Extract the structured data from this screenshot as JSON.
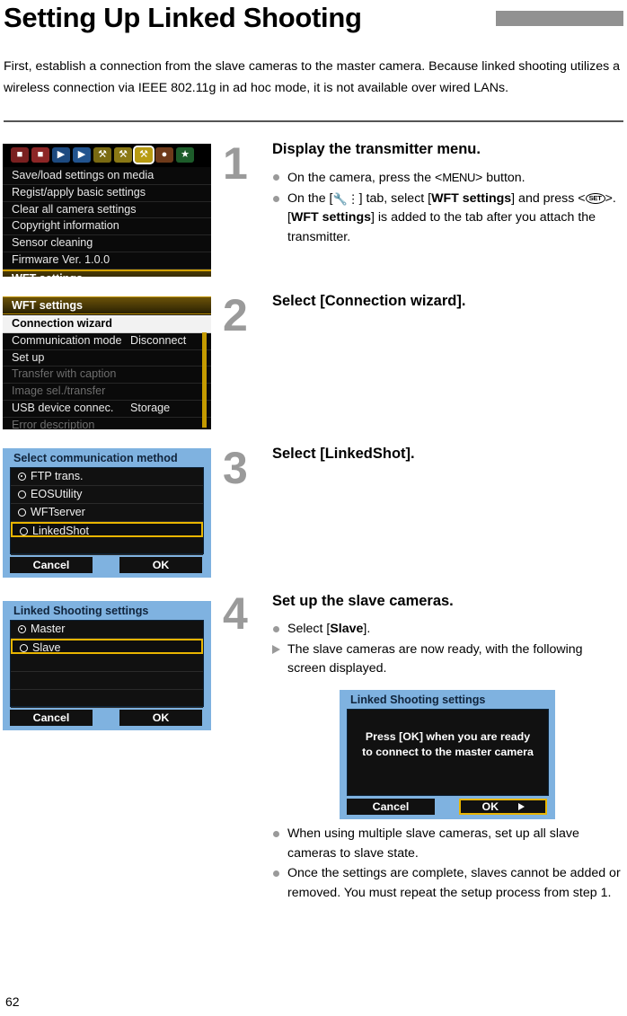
{
  "header": {
    "title": "Setting Up Linked Shooting",
    "intro": "First, establish a connection from the slave cameras to the master camera. Because linked shooting utilizes a wireless connection via IEEE 802.11g in ad hoc mode, it is not available over wired LANs."
  },
  "page_number": "62",
  "steps": [
    {
      "number": "1",
      "heading": "Display the transmitter menu."
    },
    {
      "number": "2",
      "heading": "Select [Connection wizard]."
    },
    {
      "number": "3",
      "heading": "Select [LinkedShot]."
    },
    {
      "number": "4",
      "heading": "Set up the slave cameras."
    }
  ],
  "step1_bullets": {
    "b1_pre": "On the camera, press the <",
    "b1_key": "MENU",
    "b1_post": "> button.",
    "b2_pre": "On the [",
    "b2_tab": "ƒ",
    "b2_mid": "] tab, select [",
    "b2_bold1": "WFT settings",
    "b2_mid2": "] and press <",
    "b2_key": "SET",
    "b2_mid3": ">. [",
    "b2_bold2": "WFT settings",
    "b2_post": "] is added to the tab after you attach the transmitter."
  },
  "step4_bullets": {
    "b1_pre": "Select [",
    "b1_bold": "Slave",
    "b1_post": "].",
    "b2": "The slave cameras are now ready, with the following screen displayed.",
    "b3": "When using multiple slave cameras, set up all slave cameras to slave state.",
    "b4": "Once the settings are complete, slaves cannot be added or removed. You must repeat the setup process from step 1."
  },
  "screen1": {
    "tabs": [
      {
        "name": "shooting-tab-1",
        "glyph": "■",
        "color": "#7a2020"
      },
      {
        "name": "shooting-tab-2",
        "glyph": "■",
        "color": "#8d2626"
      },
      {
        "name": "playback-tab-1",
        "glyph": "▶",
        "color": "#1d4a80"
      },
      {
        "name": "playback-tab-2",
        "glyph": "▶",
        "color": "#22548f"
      },
      {
        "name": "setup-tab-1",
        "glyph": "⚒",
        "color": "#7a6a12"
      },
      {
        "name": "setup-tab-2",
        "glyph": "⚒",
        "color": "#8a7815"
      },
      {
        "name": "setup-tab-3",
        "glyph": "⚒",
        "color": "#b89b12"
      },
      {
        "name": "custom-functions-tab",
        "glyph": "●",
        "color": "#6e3a1a"
      },
      {
        "name": "my-menu-tab",
        "glyph": "★",
        "color": "#1d5c2a"
      }
    ],
    "selected_tab_index": 6,
    "items": [
      {
        "label": "Save/load settings on media",
        "value": "",
        "dim": false,
        "highlight": "none"
      },
      {
        "label": "Regist/apply basic settings",
        "value": "",
        "dim": false,
        "highlight": "none"
      },
      {
        "label": "Clear all camera settings",
        "value": "",
        "dim": false,
        "highlight": "none"
      },
      {
        "label": "Copyright information",
        "value": "",
        "dim": false,
        "highlight": "none"
      },
      {
        "label": "Sensor cleaning",
        "value": "",
        "dim": false,
        "highlight": "none"
      },
      {
        "label": "Firmware Ver. 1.0.0",
        "value": "",
        "dim": false,
        "highlight": "none"
      },
      {
        "label": "WFT settings",
        "value": "",
        "dim": false,
        "highlight": "amber"
      }
    ]
  },
  "screen2": {
    "title": "WFT settings",
    "items": [
      {
        "label": "Connection wizard",
        "value": "",
        "dim": false,
        "highlight": "white"
      },
      {
        "label": "Communication mode",
        "value": "Disconnect",
        "dim": false,
        "highlight": "none"
      },
      {
        "label": "Set up",
        "value": "",
        "dim": false,
        "highlight": "none"
      },
      {
        "label": "Transfer with caption",
        "value": "",
        "dim": true,
        "highlight": "none"
      },
      {
        "label": "Image sel./transfer",
        "value": "",
        "dim": true,
        "highlight": "none"
      },
      {
        "label": "USB device connec.",
        "value": "Storage",
        "dim": false,
        "highlight": "none"
      },
      {
        "label": "Error description",
        "value": "",
        "dim": true,
        "highlight": "none"
      }
    ]
  },
  "screen3": {
    "title": "Select communication method",
    "options": [
      {
        "label": "FTP trans.",
        "checked": true,
        "selected": false
      },
      {
        "label": "EOSUtility",
        "checked": false,
        "selected": false
      },
      {
        "label": "WFTserver",
        "checked": false,
        "selected": false
      },
      {
        "label": "LinkedShot",
        "checked": false,
        "selected": true
      }
    ],
    "cancel_label": "Cancel",
    "ok_label": "OK"
  },
  "screen4": {
    "title": "Linked Shooting settings",
    "options": [
      {
        "label": "Master",
        "checked": true,
        "selected": false
      },
      {
        "label": "Slave",
        "checked": false,
        "selected": true
      }
    ],
    "cancel_label": "Cancel",
    "ok_label": "OK"
  },
  "screen5": {
    "title": "Linked Shooting settings",
    "message_line1": "Press [OK] when you are ready",
    "message_line2": "to connect to the master camera",
    "cancel_label": "Cancel",
    "ok_label": "OK"
  },
  "colors": {
    "accent_amber": "#e9b500",
    "lcd_blue": "#7fb2e0",
    "lcd_dark": "#0a0a0a",
    "step_gray": "#9a9a9a",
    "rule_gray": "#919191"
  }
}
